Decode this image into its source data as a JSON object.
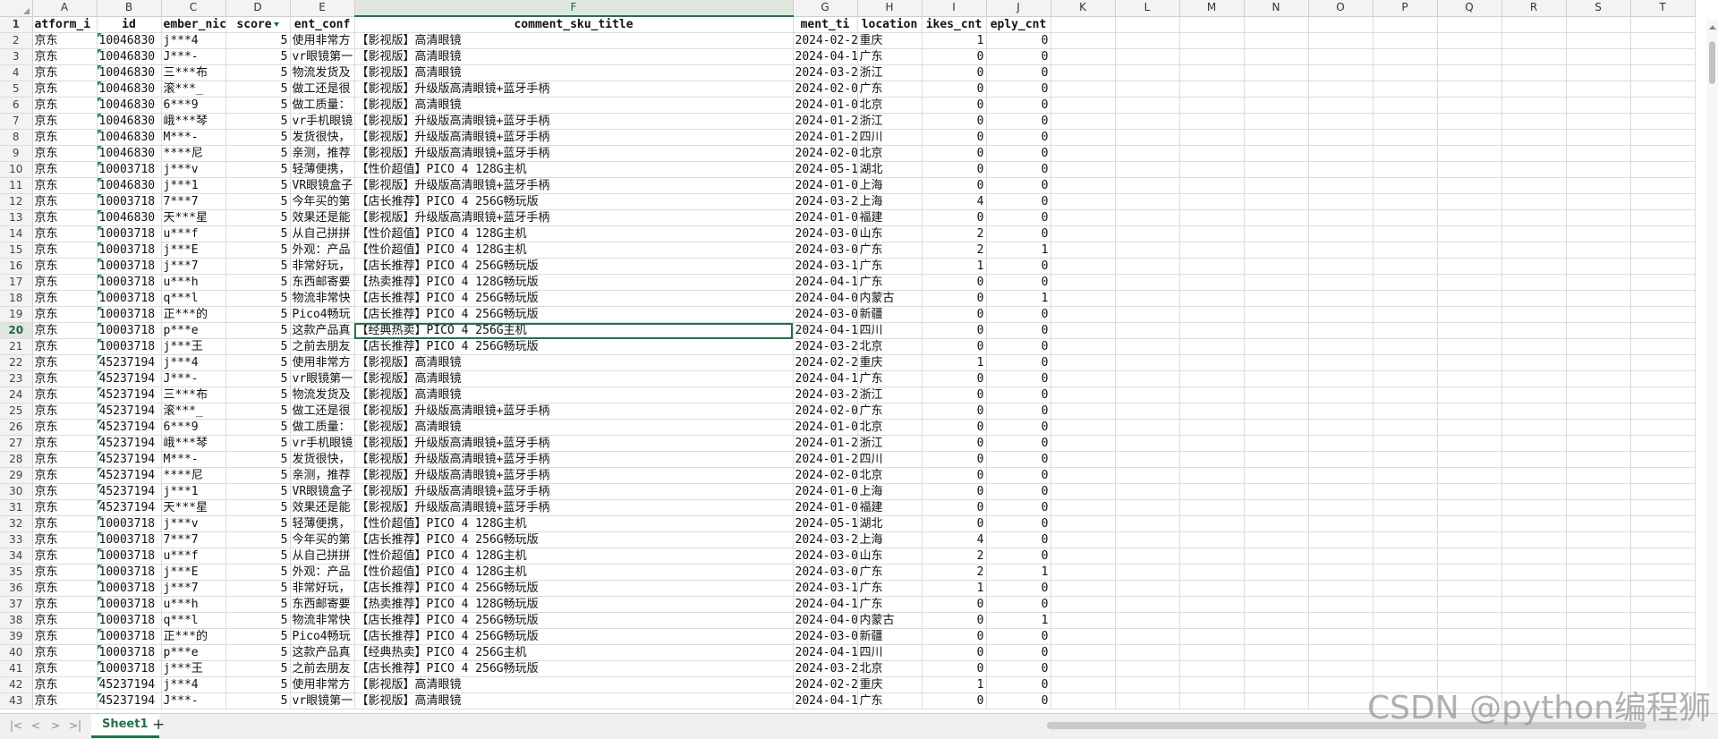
{
  "columns": [
    "A",
    "B",
    "C",
    "D",
    "E",
    "F",
    "G",
    "H",
    "I",
    "J",
    "K",
    "L",
    "M",
    "N",
    "O",
    "P",
    "Q",
    "R",
    "S",
    "T"
  ],
  "header_fields": [
    "atform_i",
    "id",
    "ember_nic",
    "score",
    "ent_conf",
    "comment_sku_title",
    "ment_ti",
    "location",
    "ikes_cnt",
    "eply_cnt"
  ],
  "rows": [
    [
      "京东",
      "10046830",
      "j***4",
      "5",
      "使用非常方",
      "【影视版】高清眼镜",
      "2024-02-2",
      "重庆",
      "1",
      "0"
    ],
    [
      "京东",
      "10046830",
      "J***-",
      "5",
      "vr眼镜第一",
      "【影视版】高清眼镜",
      "2024-04-1",
      "广东",
      "0",
      "0"
    ],
    [
      "京东",
      "10046830",
      "三***布",
      "5",
      "物流发货及",
      "【影视版】高清眼镜",
      "2024-03-2",
      "浙江",
      "0",
      "0"
    ],
    [
      "京东",
      "10046830",
      "滚***_",
      "5",
      "做工还是很",
      "【影视版】升级版高清眼镜+蓝牙手柄",
      "2024-02-0",
      "广东",
      "0",
      "0"
    ],
    [
      "京东",
      "10046830",
      "6***9",
      "5",
      "做工质量：",
      "【影视版】高清眼镜",
      "2024-01-0",
      "北京",
      "0",
      "0"
    ],
    [
      "京东",
      "10046830",
      "峨***琴",
      "5",
      "vr手机眼镜",
      "【影视版】升级版高清眼镜+蓝牙手柄",
      "2024-01-2",
      "浙江",
      "0",
      "0"
    ],
    [
      "京东",
      "10046830",
      "M***-",
      "5",
      "发货很快，",
      "【影视版】升级版高清眼镜+蓝牙手柄",
      "2024-01-2",
      "四川",
      "0",
      "0"
    ],
    [
      "京东",
      "10046830",
      "****尼",
      "5",
      "亲测，推荐",
      "【影视版】升级版高清眼镜+蓝牙手柄",
      "2024-02-0",
      "北京",
      "0",
      "0"
    ],
    [
      "京东",
      "10003718",
      "j***v",
      "5",
      "轻薄便携，",
      "【性价超值】PICO 4  128G主机",
      "2024-05-1",
      "湖北",
      "0",
      "0"
    ],
    [
      "京东",
      "10046830",
      "j***1",
      "5",
      "VR眼镜盒子",
      "【影视版】升级版高清眼镜+蓝牙手柄",
      "2024-01-0",
      "上海",
      "0",
      "0"
    ],
    [
      "京东",
      "10003718",
      "7***7",
      "5",
      "今年买的第",
      "【店长推荐】PICO 4 256G畅玩版",
      "2024-03-2",
      "上海",
      "4",
      "0"
    ],
    [
      "京东",
      "10046830",
      "天***星",
      "5",
      "效果还是能",
      "【影视版】升级版高清眼镜+蓝牙手柄",
      "2024-01-0",
      "福建",
      "0",
      "0"
    ],
    [
      "京东",
      "10003718",
      "u***f",
      "5",
      "从自己拼拼",
      "【性价超值】PICO 4  128G主机",
      "2024-03-0",
      "山东",
      "2",
      "0"
    ],
    [
      "京东",
      "10003718",
      "j***E",
      "5",
      "外观：产品",
      "【性价超值】PICO 4  128G主机",
      "2024-03-0",
      "广东",
      "2",
      "1"
    ],
    [
      "京东",
      "10003718",
      "j***7",
      "5",
      "非常好玩，",
      "【店长推荐】PICO 4 256G畅玩版",
      "2024-03-1",
      "广东",
      "1",
      "0"
    ],
    [
      "京东",
      "10003718",
      "u***h",
      "5",
      "东西邮寄要",
      "【热卖推荐】PICO 4 128G畅玩版",
      "2024-04-1",
      "广东",
      "0",
      "0"
    ],
    [
      "京东",
      "10003718",
      "q***l",
      "5",
      "物流非常快",
      "【店长推荐】PICO 4 256G畅玩版",
      "2024-04-0",
      "内蒙古",
      "0",
      "1"
    ],
    [
      "京东",
      "10003718",
      "正***的",
      "5",
      "Pico4畅玩",
      "【店长推荐】PICO 4 256G畅玩版",
      "2024-03-0",
      "新疆",
      "0",
      "0"
    ],
    [
      "京东",
      "10003718",
      "p***e",
      "5",
      "这款产品真",
      "【经典热卖】PICO 4 256G主机",
      "2024-04-1",
      "四川",
      "0",
      "0"
    ],
    [
      "京东",
      "10003718",
      "j***王",
      "5",
      "之前去朋友",
      "【店长推荐】PICO 4 256G畅玩版",
      "2024-03-2",
      "北京",
      "0",
      "0"
    ],
    [
      "京东",
      "45237194",
      "j***4",
      "5",
      "使用非常方",
      "【影视版】高清眼镜",
      "2024-02-2",
      "重庆",
      "1",
      "0"
    ],
    [
      "京东",
      "45237194",
      "J***-",
      "5",
      "vr眼镜第一",
      "【影视版】高清眼镜",
      "2024-04-1",
      "广东",
      "0",
      "0"
    ],
    [
      "京东",
      "45237194",
      "三***布",
      "5",
      "物流发货及",
      "【影视版】高清眼镜",
      "2024-03-2",
      "浙江",
      "0",
      "0"
    ],
    [
      "京东",
      "45237194",
      "滚***_",
      "5",
      "做工还是很",
      "【影视版】升级版高清眼镜+蓝牙手柄",
      "2024-02-0",
      "广东",
      "0",
      "0"
    ],
    [
      "京东",
      "45237194",
      "6***9",
      "5",
      "做工质量：",
      "【影视版】高清眼镜",
      "2024-01-0",
      "北京",
      "0",
      "0"
    ],
    [
      "京东",
      "45237194",
      "峨***琴",
      "5",
      "vr手机眼镜",
      "【影视版】升级版高清眼镜+蓝牙手柄",
      "2024-01-2",
      "浙江",
      "0",
      "0"
    ],
    [
      "京东",
      "45237194",
      "M***-",
      "5",
      "发货很快，",
      "【影视版】升级版高清眼镜+蓝牙手柄",
      "2024-01-2",
      "四川",
      "0",
      "0"
    ],
    [
      "京东",
      "45237194",
      "****尼",
      "5",
      "亲测，推荐",
      "【影视版】升级版高清眼镜+蓝牙手柄",
      "2024-02-0",
      "北京",
      "0",
      "0"
    ],
    [
      "京东",
      "45237194",
      "j***1",
      "5",
      "VR眼镜盒子",
      "【影视版】升级版高清眼镜+蓝牙手柄",
      "2024-01-0",
      "上海",
      "0",
      "0"
    ],
    [
      "京东",
      "45237194",
      "天***星",
      "5",
      "效果还是能",
      "【影视版】升级版高清眼镜+蓝牙手柄",
      "2024-01-0",
      "福建",
      "0",
      "0"
    ],
    [
      "京东",
      "10003718",
      "j***v",
      "5",
      "轻薄便携，",
      "【性价超值】PICO 4  128G主机",
      "2024-05-1",
      "湖北",
      "0",
      "0"
    ],
    [
      "京东",
      "10003718",
      "7***7",
      "5",
      "今年买的第",
      "【店长推荐】PICO 4 256G畅玩版",
      "2024-03-2",
      "上海",
      "4",
      "0"
    ],
    [
      "京东",
      "10003718",
      "u***f",
      "5",
      "从自己拼拼",
      "【性价超值】PICO 4  128G主机",
      "2024-03-0",
      "山东",
      "2",
      "0"
    ],
    [
      "京东",
      "10003718",
      "j***E",
      "5",
      "外观：产品",
      "【性价超值】PICO 4  128G主机",
      "2024-03-0",
      "广东",
      "2",
      "1"
    ],
    [
      "京东",
      "10003718",
      "j***7",
      "5",
      "非常好玩，",
      "【店长推荐】PICO 4 256G畅玩版",
      "2024-03-1",
      "广东",
      "1",
      "0"
    ],
    [
      "京东",
      "10003718",
      "u***h",
      "5",
      "东西邮寄要",
      "【热卖推荐】PICO 4 128G畅玩版",
      "2024-04-1",
      "广东",
      "0",
      "0"
    ],
    [
      "京东",
      "10003718",
      "q***l",
      "5",
      "物流非常快",
      "【店长推荐】PICO 4 256G畅玩版",
      "2024-04-0",
      "内蒙古",
      "0",
      "1"
    ],
    [
      "京东",
      "10003718",
      "正***的",
      "5",
      "Pico4畅玩",
      "【店长推荐】PICO 4 256G畅玩版",
      "2024-03-0",
      "新疆",
      "0",
      "0"
    ],
    [
      "京东",
      "10003718",
      "p***e",
      "5",
      "这款产品真",
      "【经典热卖】PICO 4 256G主机",
      "2024-04-1",
      "四川",
      "0",
      "0"
    ],
    [
      "京东",
      "10003718",
      "j***王",
      "5",
      "之前去朋友",
      "【店长推荐】PICO 4 256G畅玩版",
      "2024-03-2",
      "北京",
      "0",
      "0"
    ],
    [
      "京东",
      "45237194",
      "j***4",
      "5",
      "使用非常方",
      "【影视版】高清眼镜",
      "2024-02-2",
      "重庆",
      "1",
      "0"
    ],
    [
      "京东",
      "45237194",
      "J***-",
      "5",
      "vr眼镜第一",
      "【影视版】高清眼镜",
      "2024-04-1",
      "广东",
      "0",
      "0"
    ]
  ],
  "active_cell": {
    "row": 20,
    "col": "F"
  },
  "filter_column": "D",
  "sheet": {
    "name": "Sheet1",
    "add_label": "+"
  },
  "nav_icons": {
    "first": "|<",
    "prev": "<",
    "next": ">",
    "last": ">|"
  },
  "watermark": "CSDN @python编程狮",
  "colors": {
    "accent": "#217346",
    "header_bg": "#f3f3f3",
    "selected_header_bg": "#e0e7df",
    "grid_line": "#dcdcdc"
  }
}
